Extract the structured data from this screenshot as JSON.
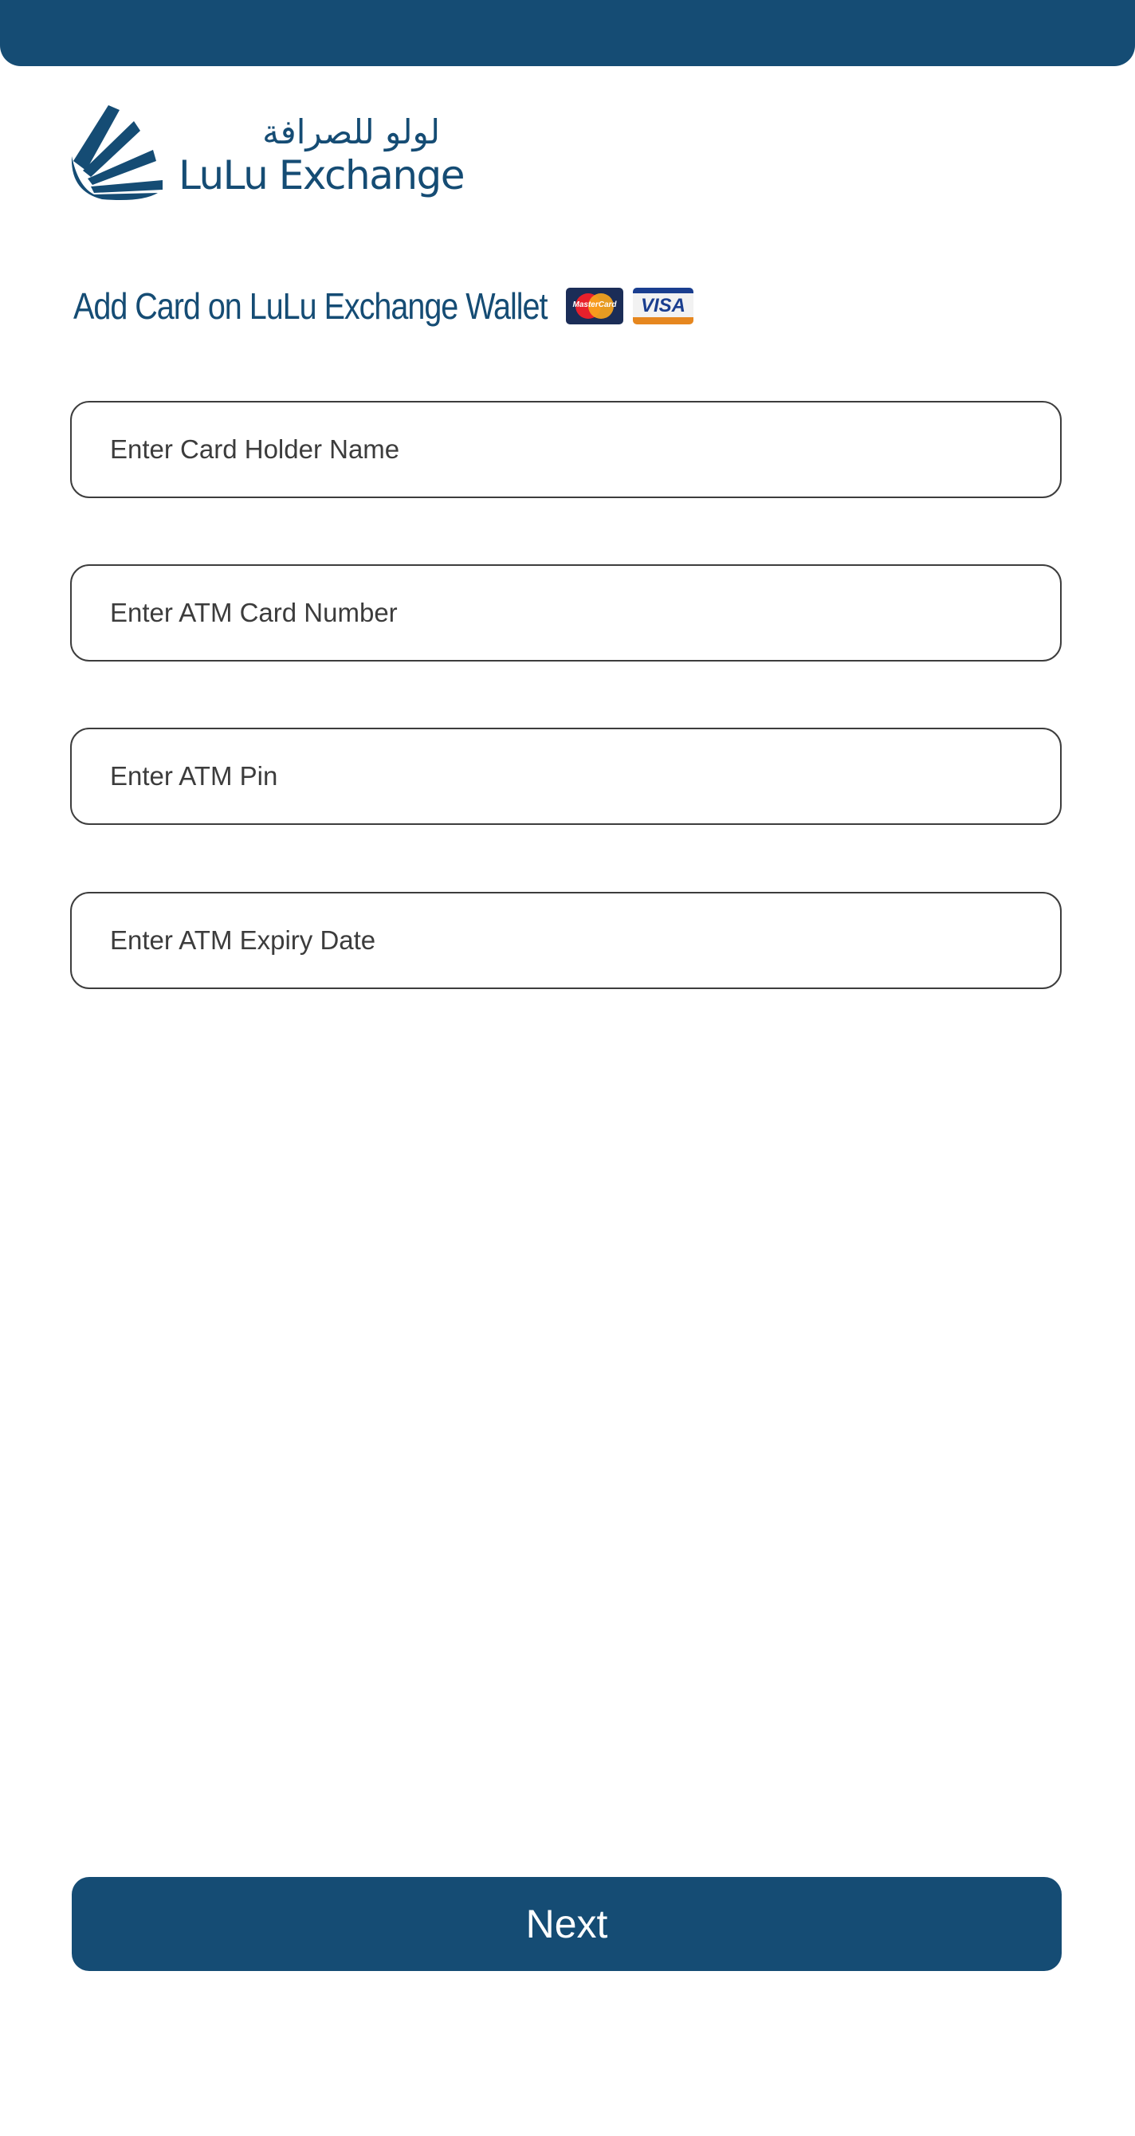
{
  "brand": {
    "name_arabic": "لولو للصرافة",
    "name_latin": "LuLu Exchange",
    "primary_color": "#154c74"
  },
  "page": {
    "title": "Add Card on LuLu Exchange Wallet",
    "card_logos": [
      "mastercard-icon",
      "visa-icon"
    ],
    "mastercard_label": "MasterCard",
    "visa_label": "VISA"
  },
  "form": {
    "card_holder_name": {
      "placeholder": "Enter Card Holder Name",
      "value": ""
    },
    "card_number": {
      "placeholder": "Enter ATM Card Number",
      "value": ""
    },
    "pin": {
      "placeholder": "Enter ATM Pin",
      "value": ""
    },
    "expiry_date": {
      "placeholder": "Enter ATM Expiry Date",
      "value": ""
    }
  },
  "actions": {
    "next_label": "Next"
  }
}
